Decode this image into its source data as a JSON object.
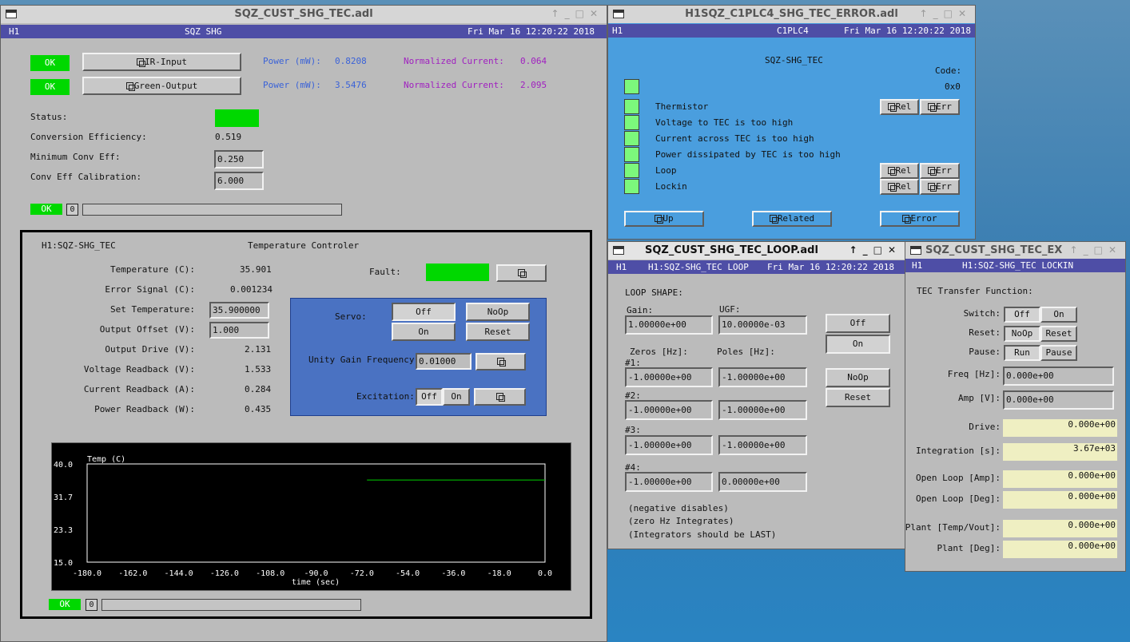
{
  "main": {
    "title": "SQZ_CUST_SHG_TEC.adl",
    "hdr_left": "H1",
    "hdr_center": "SQZ SHG",
    "hdr_date": "Fri Mar 16 12:20:22 2018",
    "ok1": "OK",
    "ok2": "OK",
    "ir_btn": "IR-Input",
    "green_btn": "Green-Output",
    "power_label": "Power (mW):",
    "power1": "0.8208",
    "power2": "3.5476",
    "norm_label": "Normalized Current:",
    "norm1": "0.064",
    "norm2": "2.095",
    "status_label": "Status:",
    "conv_eff_label": "Conversion Efficiency:",
    "conv_eff": "0.519",
    "min_conv_label": "Minimum Conv Eff:",
    "min_conv": "0.250",
    "calib_label": "Conv Eff Calibration:",
    "calib": "6.000",
    "ok3": "OK",
    "count1": "0",
    "colors": {
      "green": "#00d800",
      "header": "#4e4ea6",
      "window": "#bbbbbb"
    }
  },
  "tec": {
    "name": "H1:SQZ-SHG_TEC",
    "title": "Temperature Controler",
    "rows": [
      {
        "label": "Temperature (C):",
        "value": "35.901"
      },
      {
        "label": "Error Signal (C):",
        "value": "0.001234"
      },
      {
        "label": "Set Temperature:",
        "value": "35.900000"
      },
      {
        "label": "Output Offset (V):",
        "value": "1.000"
      },
      {
        "label": "Output Drive (V):",
        "value": "2.131"
      },
      {
        "label": "Voltage Readback (V):",
        "value": "1.533"
      },
      {
        "label": "Current Readback (A):",
        "value": "0.284"
      },
      {
        "label": "Power Readback (W):",
        "value": "0.435"
      }
    ],
    "fault_label": "Fault:",
    "servo_label": "Servo:",
    "servo_off": "Off",
    "servo_noop": "NoOp",
    "servo_on": "On",
    "servo_reset": "Reset",
    "ugf_label": "Unity Gain Frequency:",
    "ugf": "0.01000",
    "exc_label": "Excitation:",
    "exc_off": "Off",
    "exc_on": "On",
    "ok4": "OK",
    "count2": "0"
  },
  "chart_data": {
    "type": "line",
    "title": "Temp (C)",
    "xlabel": "time (sec)",
    "ylabel": "",
    "xlim": [
      -180,
      0
    ],
    "ylim": [
      15,
      40
    ],
    "xticks": [
      "-180.0",
      "-162.0",
      "-144.0",
      "-126.0",
      "-108.0",
      "-90.0",
      "-72.0",
      "-54.0",
      "-36.0",
      "-18.0",
      "0.0"
    ],
    "yticks": [
      "40.0",
      "31.7",
      "23.3",
      "15.0"
    ],
    "x": [
      -70,
      0
    ],
    "y": [
      35.9,
      35.9
    ],
    "grid": false,
    "background": "#000000",
    "line_color": "#00d000"
  },
  "err": {
    "title": "H1SQZ_C1PLC4_SHG_TEC_ERROR.adl",
    "hdr_left": "H1",
    "hdr_center": "C1PLC4",
    "hdr_date": "Fri Mar 16 12:20:22 2018",
    "heading": "SQZ-SHG_TEC",
    "code_label": "Code:",
    "code": "0x0",
    "items": [
      {
        "label": "Thermistor",
        "rel": "Rel",
        "err": "Err"
      },
      {
        "label": "Voltage to TEC is too high"
      },
      {
        "label": "Current across TEC is too high"
      },
      {
        "label": "Power dissipated by TEC is too high"
      },
      {
        "label": "Loop",
        "rel": "Rel",
        "err": "Err"
      },
      {
        "label": "Lockin",
        "rel": "Rel",
        "err": "Err"
      }
    ],
    "up_btn": "Up",
    "related_btn": "Related",
    "error_btn": "Error",
    "colors": {
      "bg": "#4a9ede",
      "ok": "#7cf87c"
    }
  },
  "loop": {
    "title": "SQZ_CUST_SHG_TEC_LOOP.adl",
    "hdr_left": "H1",
    "hdr_center": "H1:SQZ-SHG_TEC LOOP",
    "hdr_date": "Fri Mar 16 12:20:22 2018",
    "shape_label": "LOOP SHAPE:",
    "gain_label": "Gain:",
    "ugf_label": "UGF:",
    "gain": "1.00000e+00",
    "ugf": "10.00000e-03",
    "off": "Off",
    "on": "On",
    "noop": "NoOp",
    "reset": "Reset",
    "zeros_label": "Zeros [Hz]:",
    "poles_label": "Poles [Hz]:",
    "rows": [
      {
        "label": "#1:",
        "zero": "-1.00000e+00",
        "pole": "-1.00000e+00"
      },
      {
        "label": "#2:",
        "zero": "-1.00000e+00",
        "pole": "-1.00000e+00"
      },
      {
        "label": "#3:",
        "zero": "-1.00000e+00",
        "pole": "-1.00000e+00"
      },
      {
        "label": "#4:",
        "zero": "-1.00000e+00",
        "pole": "0.00000e+00"
      }
    ],
    "notes": [
      "(negative disables)",
      "(zero Hz Integrates)",
      "(Integrators should be LAST)"
    ]
  },
  "lockin": {
    "title": "SQZ_CUST_SHG_TEC_EX",
    "hdr_left": "H1",
    "hdr_center": "H1:SQZ-SHG_TEC LOCKIN",
    "tf_label": "TEC Transfer Function:",
    "switch_label": "Switch:",
    "switch_off": "Off",
    "switch_on": "On",
    "reset_label": "Reset:",
    "reset_noop": "NoOp",
    "reset_reset": "Reset",
    "pause_label": "Pause:",
    "pause_run": "Run",
    "pause_pause": "Pause",
    "freq_label": "Freq [Hz]:",
    "freq": "0.000e+00",
    "amp_label": "Amp [V]:",
    "amp": "0.000e+00",
    "readbacks": [
      {
        "label": "Drive:",
        "value": "0.000e+00"
      },
      {
        "label": "Integration [s]:",
        "value": "3.67e+03"
      },
      {
        "label": "Open Loop [Amp]:",
        "value": "0.000e+00"
      },
      {
        "label": "Open Loop [Deg]:",
        "value": "0.000e+00"
      },
      {
        "label": "Plant [Temp/Vout]:",
        "value": "0.000e+00"
      },
      {
        "label": "Plant [Deg]:",
        "value": "0.000e+00"
      }
    ]
  }
}
